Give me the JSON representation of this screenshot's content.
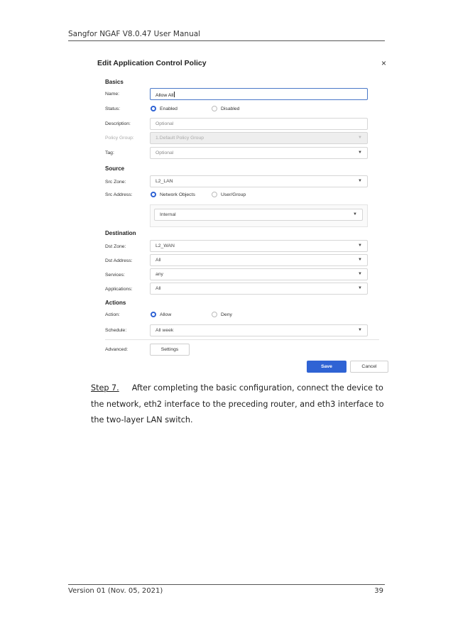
{
  "doc": {
    "header": "Sangfor NGAF V8.0.47 User Manual",
    "footer_left": "Version 01 (Nov. 05, 2021)",
    "page_number": "39"
  },
  "dialog": {
    "title": "Edit Application Control Policy",
    "close_glyph": "×",
    "basics": {
      "heading": "Basics",
      "name_label": "Name:",
      "name_value": "Allow All",
      "status_label": "Status:",
      "status_enabled": "Enabled",
      "status_disabled": "Disabled",
      "description_label": "Description:",
      "description_placeholder": "Optional",
      "policy_group_label": "Policy Group:",
      "policy_group_value": "1.Default Policy Group",
      "tag_label": "Tag:",
      "tag_placeholder": "Optional"
    },
    "source": {
      "heading": "Source",
      "zone_label": "Src Zone:",
      "zone_value": "L2_LAN",
      "address_label": "Src Address:",
      "address_opt1": "Network Objects",
      "address_opt2": "User/Group",
      "network_object_value": "Internal"
    },
    "destination": {
      "heading": "Destination",
      "zone_label": "Dst Zone:",
      "zone_value": "L2_WAN",
      "address_label": "Dst Address:",
      "address_value": "All",
      "services_label": "Services:",
      "services_value": "any",
      "applications_label": "Applications:",
      "applications_value": "All"
    },
    "actions": {
      "heading": "Actions",
      "action_label": "Action:",
      "action_allow": "Allow",
      "action_deny": "Deny",
      "schedule_label": "Schedule:",
      "schedule_value": "All week"
    },
    "advanced_label": "Advanced:",
    "settings_button": "Settings",
    "save_button": "Save",
    "cancel_button": "Cancel",
    "caret_glyph": "▼",
    "accent_color": "#2f63d4"
  },
  "step": {
    "number": "Step 7.",
    "text": "After completing the basic configuration, connect the device to the network, eth2 interface to the preceding router, and eth3 interface to the two-layer LAN switch."
  }
}
